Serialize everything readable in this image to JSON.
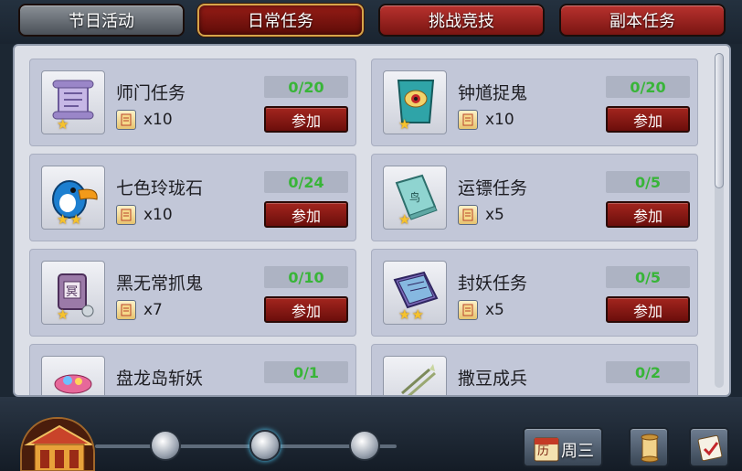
{
  "tabs": [
    {
      "label": "节日活动",
      "style": "grey"
    },
    {
      "label": "日常任务",
      "style": "active"
    },
    {
      "label": "挑战竞技",
      "style": "red"
    },
    {
      "label": "副本任务",
      "style": "red"
    }
  ],
  "tasks": [
    {
      "name": "师门任务",
      "progress": "0/20",
      "reward_count": "x10",
      "stars": 1,
      "join_label": "参加",
      "icon": "scroll-icon"
    },
    {
      "name": "钟馗捉鬼",
      "progress": "0/20",
      "reward_count": "x10",
      "stars": 1,
      "join_label": "参加",
      "icon": "eye-banner-icon"
    },
    {
      "name": "七色玲珑石",
      "progress": "0/24",
      "reward_count": "x10",
      "stars": 2,
      "join_label": "参加",
      "icon": "toucan-icon"
    },
    {
      "name": "运镖任务",
      "progress": "0/5",
      "reward_count": "x5",
      "stars": 1,
      "join_label": "参加",
      "icon": "book-icon"
    },
    {
      "name": "黑无常抓鬼",
      "progress": "0/10",
      "reward_count": "x7",
      "stars": 1,
      "join_label": "参加",
      "icon": "token-icon"
    },
    {
      "name": "封妖任务",
      "progress": "0/5",
      "reward_count": "x5",
      "stars": 2,
      "join_label": "参加",
      "icon": "tome-icon"
    },
    {
      "name": "盘龙岛斩妖",
      "progress": "0/1",
      "reward_count": "",
      "stars": 0,
      "join_label": "",
      "icon": "treasure-icon"
    },
    {
      "name": "撒豆成兵",
      "progress": "0/2",
      "reward_count": "",
      "stars": 0,
      "join_label": "",
      "icon": "arrows-icon"
    }
  ],
  "bottom": {
    "calendar_label": "历",
    "calendar_day": "周三"
  },
  "colors": {
    "progress_text": "#38b538",
    "join_button": "#8a1a15",
    "card_bg": "#c2c7d8"
  }
}
